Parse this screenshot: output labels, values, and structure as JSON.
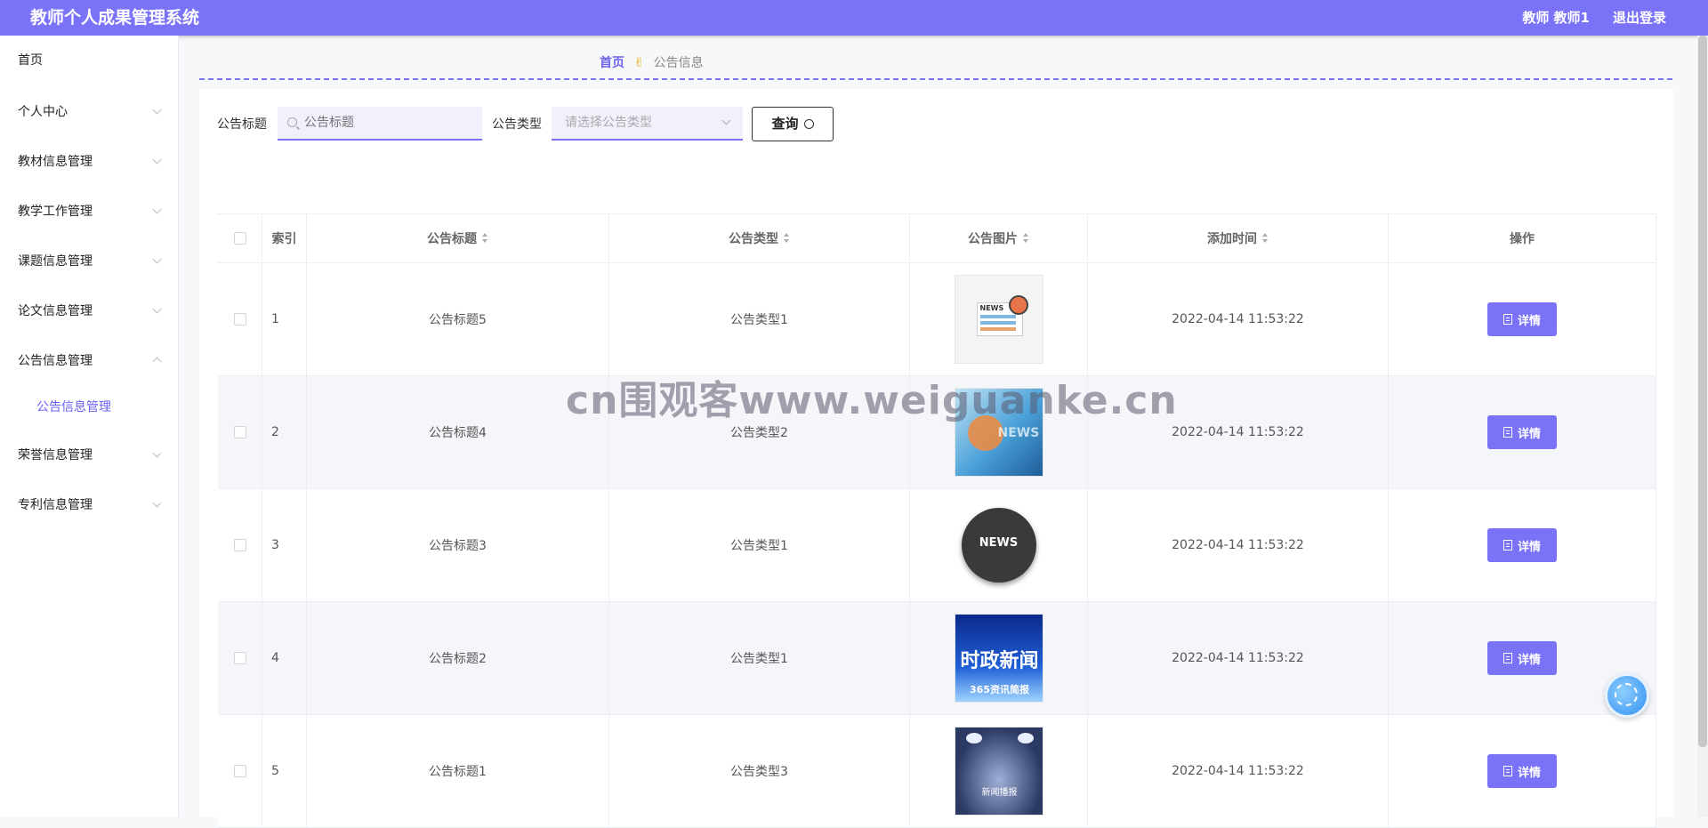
{
  "header": {
    "title": "教师个人成果管理系统",
    "user_label": "教师 教师1",
    "logout": "退出登录"
  },
  "sidebar": {
    "items": [
      {
        "label": "首页"
      },
      {
        "label": "个人中心"
      },
      {
        "label": "教材信息管理"
      },
      {
        "label": "教学工作管理"
      },
      {
        "label": "课题信息管理"
      },
      {
        "label": "论文信息管理"
      },
      {
        "label": "公告信息管理",
        "sub": "公告信息管理"
      },
      {
        "label": "荣誉信息管理"
      },
      {
        "label": "专利信息管理"
      }
    ]
  },
  "breadcrumb": {
    "home": "首页",
    "current": "公告信息"
  },
  "search": {
    "title_label": "公告标题",
    "title_placeholder": "公告标题",
    "type_label": "公告类型",
    "type_placeholder": "请选择公告类型",
    "query_label": "查询"
  },
  "table": {
    "headers": [
      "索引",
      "公告标题",
      "公告类型",
      "公告图片",
      "添加时间",
      "操作"
    ],
    "rows": [
      {
        "index": "1",
        "title": "公告标题5",
        "type": "公告类型1",
        "time": "2022-04-14 11:53:22",
        "img_text": "NEWS"
      },
      {
        "index": "2",
        "title": "公告标题4",
        "type": "公告类型2",
        "time": "2022-04-14 11:53:22",
        "img_text": "NEWS"
      },
      {
        "index": "3",
        "title": "公告标题3",
        "type": "公告类型1",
        "time": "2022-04-14 11:53:22",
        "img_text": "NEWS"
      },
      {
        "index": "4",
        "title": "公告标题2",
        "type": "公告类型1",
        "time": "2022-04-14 11:53:22",
        "img_text": "时政新闻",
        "img_sub": "365资讯简报"
      },
      {
        "index": "5",
        "title": "公告标题1",
        "type": "公告类型3",
        "time": "2022-04-14 11:53:22",
        "img_text": "新闻播报"
      }
    ],
    "detail_label": "详情"
  },
  "watermark": "cn围观客www.weiguanke.cn",
  "colors": {
    "accent": "#7a73f8",
    "row_stripe": "#f5f6fa"
  }
}
